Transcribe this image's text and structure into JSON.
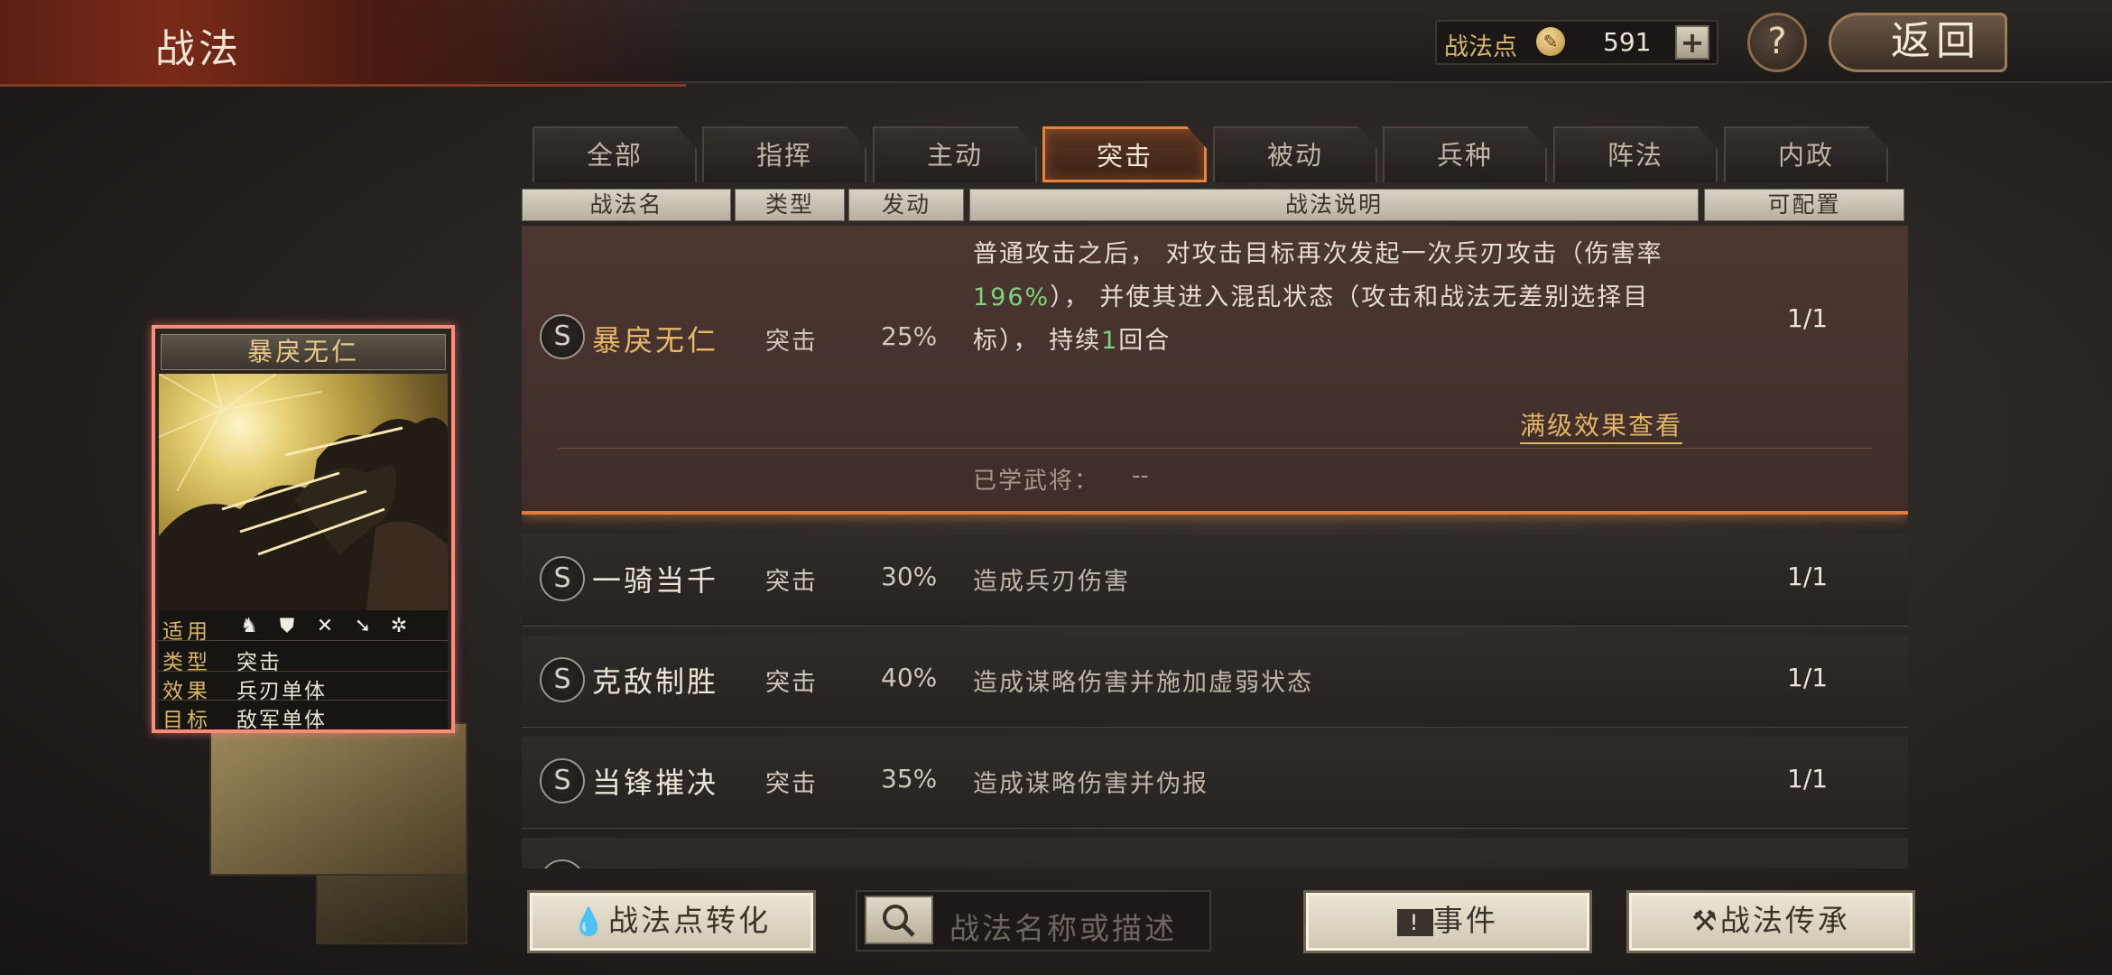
{
  "header": {
    "title": "战法",
    "points_label": "战法点",
    "points_value": "591",
    "plus_label": "+",
    "help_label": "?",
    "back_label": "返回"
  },
  "tabs": [
    {
      "label": "全部"
    },
    {
      "label": "指挥"
    },
    {
      "label": "主动"
    },
    {
      "label": "突击",
      "active": true
    },
    {
      "label": "被动"
    },
    {
      "label": "兵种"
    },
    {
      "label": "阵法"
    },
    {
      "label": "内政"
    }
  ],
  "columns": [
    "战法名",
    "类型",
    "发动",
    "战法说明",
    "可配置"
  ],
  "selected": {
    "badge": "S",
    "name": "暴戾无仁",
    "type": "突击",
    "rate": "25%",
    "desc_a": "普通攻击之后， 对攻击目标再次发起一次兵刃攻击（伤害率",
    "desc_highlight1": "196%",
    "desc_b": "）， 并使其进入混乱状态（攻击和战法无差别选择目标）， 持续",
    "desc_highlight2": "1",
    "desc_c": "回合",
    "count": "1/1",
    "max_link": "满级效果查看",
    "learned_label": "已学武将：",
    "learned_value": "--"
  },
  "rows": [
    {
      "badge": "S",
      "name": "一骑当千",
      "type": "突击",
      "rate": "30%",
      "desc": "造成兵刃伤害",
      "count": "1/1"
    },
    {
      "badge": "S",
      "name": "克敌制胜",
      "type": "突击",
      "rate": "40%",
      "desc": "造成谋略伤害并施加虚弱状态",
      "count": "1/1"
    },
    {
      "badge": "S",
      "name": "当锋摧决",
      "type": "突击",
      "rate": "35%",
      "desc": "造成谋略伤害并伪报",
      "count": "1/1"
    }
  ],
  "card": {
    "name": "暴戾无仁",
    "stats": [
      {
        "key": "适用",
        "value": ""
      },
      {
        "key": "类型",
        "value": "突击"
      },
      {
        "key": "效果",
        "value": "兵刃单体"
      },
      {
        "key": "目标",
        "value": "敌军单体"
      }
    ],
    "apply_icons": [
      "cavalry-icon",
      "shield-icon",
      "bow-icon",
      "spear-icon",
      "siege-wheel-icon"
    ]
  },
  "bottom": {
    "convert_label": "战法点转化",
    "search_placeholder": "战法名称或描述",
    "events_label": "事件",
    "inherit_label": "战法传承"
  },
  "colors": {
    "accent_orange": "#e8823a",
    "gold_text": "#e6b765",
    "highlight_green": "#7fd37a",
    "card_border": "#ff8a7a"
  }
}
